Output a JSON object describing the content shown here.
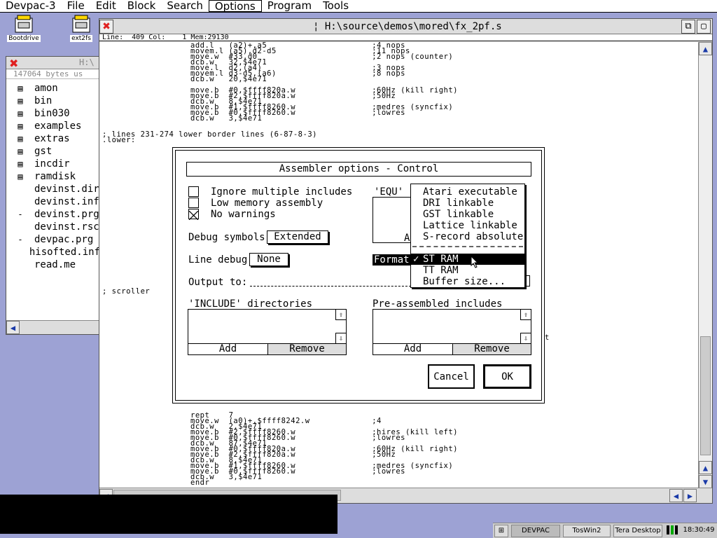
{
  "menubar": {
    "items": [
      "Devpac-3",
      "File",
      "Edit",
      "Block",
      "Search",
      "Options",
      "Program",
      "Tools"
    ],
    "active": "Options"
  },
  "desktop_icons": [
    {
      "label": "Bootdrive"
    },
    {
      "label": "ext2fs"
    }
  ],
  "file_window": {
    "title": "H:\\",
    "info": "147064 bytes us",
    "items": [
      {
        "mark": "▤",
        "name": "amon"
      },
      {
        "mark": "▤",
        "name": "bin"
      },
      {
        "mark": "▤",
        "name": "bin030"
      },
      {
        "mark": "▤",
        "name": "examples"
      },
      {
        "mark": "▤",
        "name": "extras"
      },
      {
        "mark": "▤",
        "name": "gst"
      },
      {
        "mark": "▤",
        "name": "incdir"
      },
      {
        "mark": "▤",
        "name": "ramdisk"
      },
      {
        "mark": "",
        "name": "devinst.dir"
      },
      {
        "mark": "",
        "name": "devinst.inf"
      },
      {
        "mark": "-",
        "name": "devinst.prg"
      },
      {
        "mark": "",
        "name": "devinst.rsc"
      },
      {
        "mark": "-",
        "name": "devpac.prg"
      },
      {
        "mark": "",
        "name": "hisofted.inf"
      },
      {
        "mark": "",
        "name": "read.me"
      }
    ]
  },
  "editor": {
    "title": "H:\\source\\demos\\mored\\fx_2pf.s",
    "status": "Line:  409 Col:    1 Mem:29130",
    "code_top": [
      "add.l   (a2)+,a5                      ;4 nops",
      "movem.l (a5),d2-d5                    ;11 nops",
      "move.w  #33,d0                        ;2 nops (counter)",
      "dcb.w   32,$4e71",
      "move.l  d2,(a4)                       ;3 nops",
      "movem.l d3-d5,(a6)                    ;8 nops",
      "dcb.w   20,$4e71",
      "",
      "move.b  #0,$ffff820a.w                ;60Hz (kill right)",
      "move.b  #2,$ffff820a.w                ;50Hz",
      "dcb.w   8,$4e71",
      "move.b  #1,$ffff8260.w                ;medres (syncfix)",
      "move.b  #0,$ffff8260.w                ;lowres",
      "dcb.w   3,$4e71"
    ],
    "comment1": "; lines 231-274 lower border lines (6-87-8-3)",
    "label1": ".lower:",
    "comment2": "; scroller",
    "code_bottom": [
      "rept    7",
      "move.w  (a0)+,$ffff8242.w             ;4",
      "dcb.w   2,$4e71",
      "move.b  #2,$ffff8260.w                ;hires (kill left)",
      "move.b  #0,$ffff8260.w                ;lowres",
      "dcb.w   87,$4e71",
      "move.b  #0,$ffff820a.w                ;60Hz (kill right)",
      "move.b  #2,$ffff820a.w                ;50Hz",
      "dcb.w   8,$4e71",
      "move.b  #1,$ffff8260.w                ;medres (syncfix)",
      "move.b  #0,$ffff8260.w                ;lowres",
      "dcb.w   3,$4e71",
      "endr"
    ],
    "right_fragment": "t"
  },
  "dialog": {
    "title": "Assembler options - Control",
    "options": [
      {
        "label": "Ignore multiple includes",
        "checked": false
      },
      {
        "label": "Low memory assembly",
        "checked": false
      },
      {
        "label": "No warnings",
        "checked": true
      }
    ],
    "equ_label": "'EQU' s",
    "equ_add_fragment": "A",
    "debug_symbols_label": "Debug symbols",
    "debug_symbols_value": "Extended",
    "line_debug_label": "Line debug",
    "line_debug_value": "None",
    "format_label": "Format",
    "output_label": "Output to:",
    "include_label": "'INCLUDE' directories",
    "preassembled_label": "Pre-assembled includes",
    "add_label": "Add",
    "remove_label": "Remove",
    "cancel_label": "Cancel",
    "ok_label": "OK"
  },
  "format_popup": {
    "items": [
      "Atari executable",
      "DRI linkable",
      "GST linkable",
      "Lattice linkable",
      "S-record absolute"
    ],
    "mem_items": [
      "ST RAM",
      "TT RAM",
      "Buffer size..."
    ],
    "selected": "ST RAM",
    "checkmark": "✓"
  },
  "taskbar": {
    "items": [
      "DEVPAC",
      "TosWin2",
      "Tera Desktop"
    ],
    "clock": "18:30:49"
  }
}
